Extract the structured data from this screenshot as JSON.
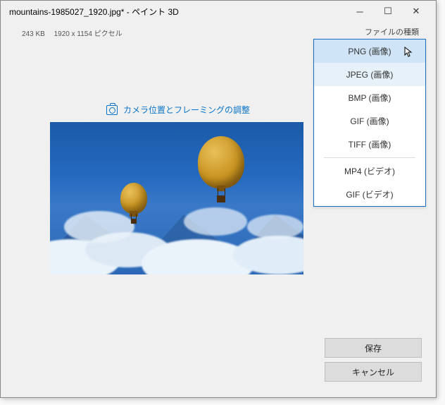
{
  "titlebar": {
    "title": "mountains-1985027_1920.jpg* - ペイント 3D"
  },
  "meta": {
    "filesize": "243 KB",
    "dimensions": "1920 x 1154 ピクセル"
  },
  "adjust": {
    "label": "カメラ位置とフレーミングの調整"
  },
  "side": {
    "label": "ファイルの種類"
  },
  "filetypes": {
    "png": "PNG (画像)",
    "jpeg": "JPEG (画像)",
    "bmp": "BMP (画像)",
    "gif": "GIF (画像)",
    "tiff": "TIFF (画像)",
    "mp4": "MP4 (ビデオ)",
    "gifv": "GIF (ビデオ)"
  },
  "buttons": {
    "save": "保存",
    "cancel": "キャンセル"
  }
}
